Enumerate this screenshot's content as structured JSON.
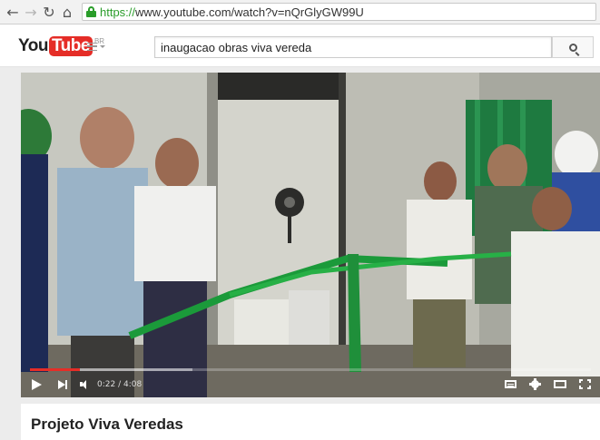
{
  "browser": {
    "url_scheme": "https://",
    "url_rest": "www.youtube.com/watch?v=nQrGlyGW99U",
    "back_icon": "back-arrow-icon",
    "forward_icon": "forward-arrow-icon",
    "reload_icon": "reload-icon",
    "home_icon": "home-icon"
  },
  "header": {
    "logo_you": "You",
    "logo_tube": "Tube",
    "logo_country": "BR",
    "search_value": "inaugacao obras viva vereda"
  },
  "player": {
    "current_time": "0:22",
    "duration": "4:08",
    "time_display": "0:22 / 4:08",
    "played_fraction": 0.089,
    "buffered_fraction": 0.29
  },
  "video": {
    "title": "Projeto Viva Veredas"
  },
  "colors": {
    "brand_red": "#e52d27",
    "secure_green": "#2a9d2a"
  }
}
